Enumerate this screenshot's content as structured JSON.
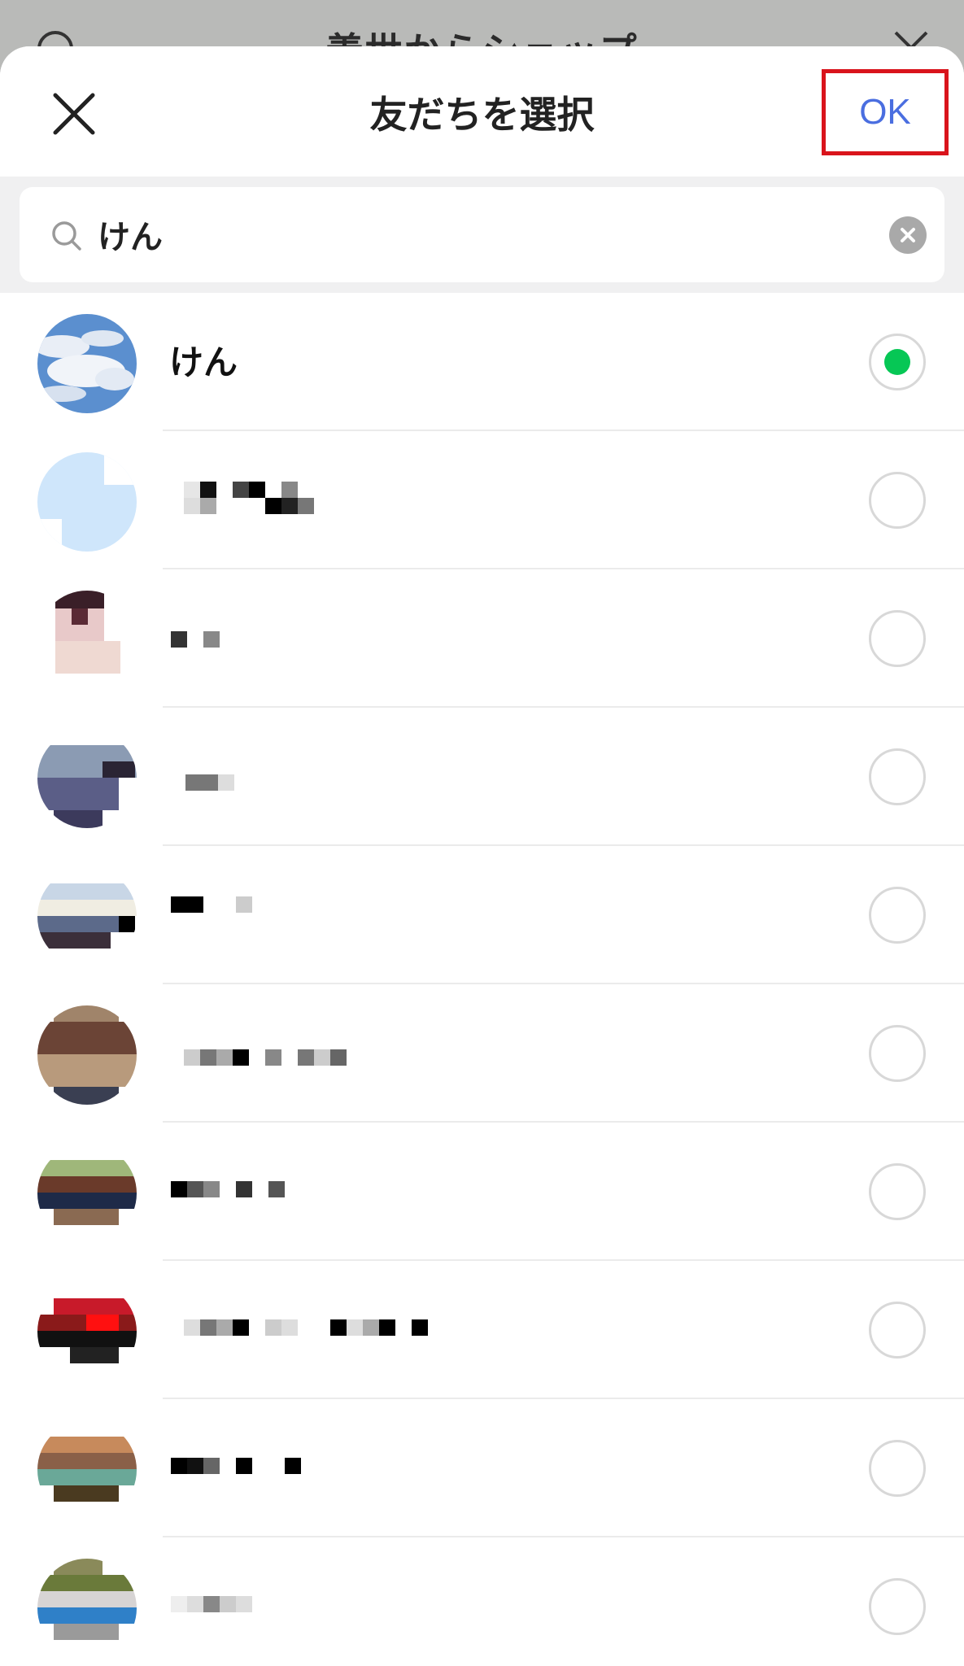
{
  "background_sheet": {
    "title": "義丗からシェップ"
  },
  "header": {
    "title": "友だちを選択",
    "ok_label": "OK"
  },
  "search": {
    "value": "けん",
    "placeholder": ""
  },
  "friends": [
    {
      "name": "けん",
      "selected": true,
      "avatar": "sky-photo"
    },
    {
      "name": "",
      "selected": false,
      "avatar": "pixelated"
    },
    {
      "name": "",
      "selected": false,
      "avatar": "pixelated"
    },
    {
      "name": "",
      "selected": false,
      "avatar": "pixelated"
    },
    {
      "name": "",
      "selected": false,
      "avatar": "pixelated"
    },
    {
      "name": "",
      "selected": false,
      "avatar": "pixelated"
    },
    {
      "name": "",
      "selected": false,
      "avatar": "pixelated"
    },
    {
      "name": "",
      "selected": false,
      "avatar": "pixelated"
    },
    {
      "name": "",
      "selected": false,
      "avatar": "pixelated"
    },
    {
      "name": "",
      "selected": false,
      "avatar": "pixelated"
    }
  ],
  "colors": {
    "accent_green": "#06c755",
    "ok_blue": "#4a6ee0",
    "highlight_red": "#d9141c"
  }
}
